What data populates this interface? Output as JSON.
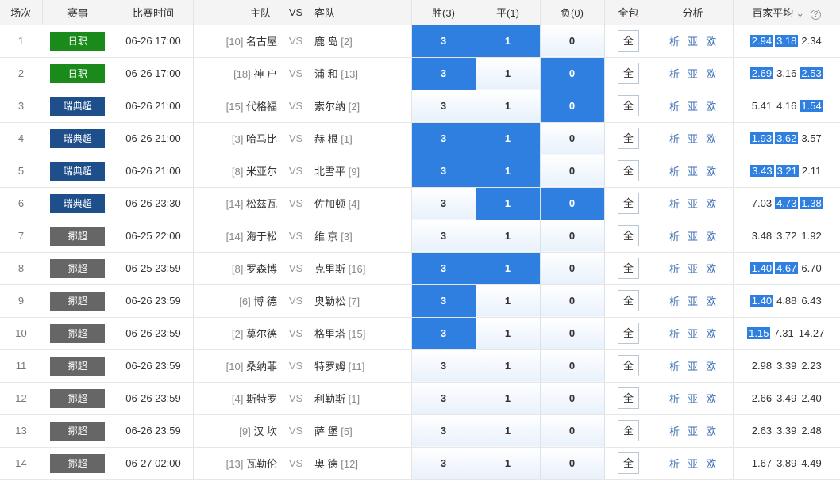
{
  "headers": {
    "idx": "场次",
    "league": "赛事",
    "time": "比赛时间",
    "home": "主队",
    "vs": "VS",
    "away": "客队",
    "win": "胜(3)",
    "draw": "平(1)",
    "lose": "负(0)",
    "all": "全包",
    "analysis": "分析",
    "avg": "百家平均",
    "chevron": "⌄",
    "help": "?"
  },
  "colors": {
    "league_jleague": "#1a8a1a",
    "league_allsvenskan": "#1f4f8a",
    "league_eliteserien": "#666666",
    "selected": "#2f7fe0"
  },
  "labels": {
    "sel_win": "3",
    "sel_draw": "1",
    "sel_lose": "0",
    "all": "全",
    "analysis_a": "析",
    "analysis_b": "亚",
    "analysis_c": "欧",
    "vs": "VS"
  },
  "matches": [
    {
      "idx": "1",
      "league": "日职",
      "league_color": "#1a8a1a",
      "time": "06-26 17:00",
      "home_rank": "[10]",
      "home": "名古屋",
      "away": "鹿 岛",
      "away_rank": "[2]",
      "sel": {
        "win": true,
        "draw": true,
        "lose": false
      },
      "odds": [
        "2.94",
        "3.18",
        "2.34"
      ],
      "odds_hi": [
        true,
        true,
        false
      ]
    },
    {
      "idx": "2",
      "league": "日职",
      "league_color": "#1a8a1a",
      "time": "06-26 17:00",
      "home_rank": "[18]",
      "home": "神 户",
      "away": "浦 和",
      "away_rank": "[13]",
      "sel": {
        "win": true,
        "draw": false,
        "lose": true
      },
      "odds": [
        "2.69",
        "3.16",
        "2.53"
      ],
      "odds_hi": [
        true,
        false,
        true
      ]
    },
    {
      "idx": "3",
      "league": "瑞典超",
      "league_color": "#1f4f8a",
      "time": "06-26 21:00",
      "home_rank": "[15]",
      "home": "代格福",
      "away": "索尔纳",
      "away_rank": "[2]",
      "sel": {
        "win": false,
        "draw": false,
        "lose": true
      },
      "odds": [
        "5.41",
        "4.16",
        "1.54"
      ],
      "odds_hi": [
        false,
        false,
        true
      ]
    },
    {
      "idx": "4",
      "league": "瑞典超",
      "league_color": "#1f4f8a",
      "time": "06-26 21:00",
      "home_rank": "[3]",
      "home": "哈马比",
      "away": "赫 根",
      "away_rank": "[1]",
      "sel": {
        "win": true,
        "draw": true,
        "lose": false
      },
      "odds": [
        "1.93",
        "3.62",
        "3.57"
      ],
      "odds_hi": [
        true,
        true,
        false
      ]
    },
    {
      "idx": "5",
      "league": "瑞典超",
      "league_color": "#1f4f8a",
      "time": "06-26 21:00",
      "home_rank": "[8]",
      "home": "米亚尔",
      "away": "北雪平",
      "away_rank": "[9]",
      "sel": {
        "win": true,
        "draw": true,
        "lose": false
      },
      "odds": [
        "3.43",
        "3.21",
        "2.11"
      ],
      "odds_hi": [
        true,
        true,
        false
      ]
    },
    {
      "idx": "6",
      "league": "瑞典超",
      "league_color": "#1f4f8a",
      "time": "06-26 23:30",
      "home_rank": "[14]",
      "home": "松兹瓦",
      "away": "佐加顿",
      "away_rank": "[4]",
      "sel": {
        "win": false,
        "draw": true,
        "lose": true
      },
      "odds": [
        "7.03",
        "4.73",
        "1.38"
      ],
      "odds_hi": [
        false,
        true,
        true
      ]
    },
    {
      "idx": "7",
      "league": "挪超",
      "league_color": "#666666",
      "time": "06-25 22:00",
      "home_rank": "[14]",
      "home": "海于松",
      "away": "维 京",
      "away_rank": "[3]",
      "sel": {
        "win": false,
        "draw": false,
        "lose": false
      },
      "odds": [
        "3.48",
        "3.72",
        "1.92"
      ],
      "odds_hi": [
        false,
        false,
        false
      ]
    },
    {
      "idx": "8",
      "league": "挪超",
      "league_color": "#666666",
      "time": "06-25 23:59",
      "home_rank": "[8]",
      "home": "罗森博",
      "away": "克里斯",
      "away_rank": "[16]",
      "sel": {
        "win": true,
        "draw": true,
        "lose": false
      },
      "odds": [
        "1.40",
        "4.67",
        "6.70"
      ],
      "odds_hi": [
        true,
        true,
        false
      ]
    },
    {
      "idx": "9",
      "league": "挪超",
      "league_color": "#666666",
      "time": "06-26 23:59",
      "home_rank": "[6]",
      "home": "博 德",
      "away": "奥勒松",
      "away_rank": "[7]",
      "sel": {
        "win": true,
        "draw": false,
        "lose": false
      },
      "odds": [
        "1.40",
        "4.88",
        "6.43"
      ],
      "odds_hi": [
        true,
        false,
        false
      ]
    },
    {
      "idx": "10",
      "league": "挪超",
      "league_color": "#666666",
      "time": "06-26 23:59",
      "home_rank": "[2]",
      "home": "莫尔德",
      "away": "格里塔",
      "away_rank": "[15]",
      "sel": {
        "win": true,
        "draw": false,
        "lose": false
      },
      "odds": [
        "1.15",
        "7.31",
        "14.27"
      ],
      "odds_hi": [
        true,
        false,
        false
      ]
    },
    {
      "idx": "11",
      "league": "挪超",
      "league_color": "#666666",
      "time": "06-26 23:59",
      "home_rank": "[10]",
      "home": "桑纳菲",
      "away": "特罗姆",
      "away_rank": "[11]",
      "sel": {
        "win": false,
        "draw": false,
        "lose": false
      },
      "odds": [
        "2.98",
        "3.39",
        "2.23"
      ],
      "odds_hi": [
        false,
        false,
        false
      ]
    },
    {
      "idx": "12",
      "league": "挪超",
      "league_color": "#666666",
      "time": "06-26 23:59",
      "home_rank": "[4]",
      "home": "斯特罗",
      "away": "利勒斯",
      "away_rank": "[1]",
      "sel": {
        "win": false,
        "draw": false,
        "lose": false
      },
      "odds": [
        "2.66",
        "3.49",
        "2.40"
      ],
      "odds_hi": [
        false,
        false,
        false
      ]
    },
    {
      "idx": "13",
      "league": "挪超",
      "league_color": "#666666",
      "time": "06-26 23:59",
      "home_rank": "[9]",
      "home": "汉 坎",
      "away": "萨 堡",
      "away_rank": "[5]",
      "sel": {
        "win": false,
        "draw": false,
        "lose": false
      },
      "odds": [
        "2.63",
        "3.39",
        "2.48"
      ],
      "odds_hi": [
        false,
        false,
        false
      ]
    },
    {
      "idx": "14",
      "league": "挪超",
      "league_color": "#666666",
      "time": "06-27 02:00",
      "home_rank": "[13]",
      "home": "瓦勒伦",
      "away": "奥 德",
      "away_rank": "[12]",
      "sel": {
        "win": false,
        "draw": false,
        "lose": false
      },
      "odds": [
        "1.67",
        "3.89",
        "4.49"
      ],
      "odds_hi": [
        false,
        false,
        false
      ]
    }
  ]
}
